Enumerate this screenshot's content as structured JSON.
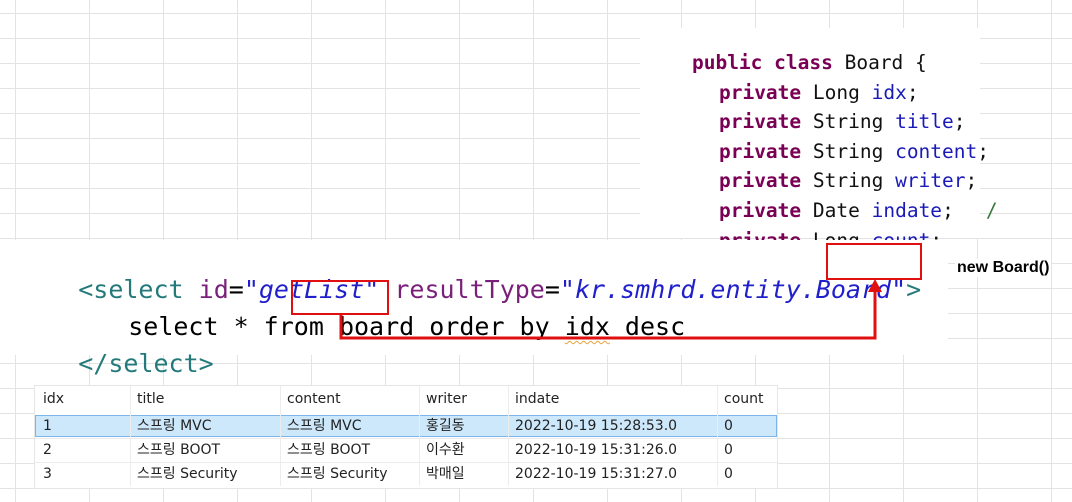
{
  "java": {
    "lines": [
      {
        "keyword": "public class",
        "rest": " Board {",
        "field": "",
        "tail": ""
      },
      {
        "keyword": "private",
        "rest": " Long ",
        "field": "idx",
        "tail": ";"
      },
      {
        "keyword": "private",
        "rest": " String ",
        "field": "title",
        "tail": ";"
      },
      {
        "keyword": "private",
        "rest": " String ",
        "field": "content",
        "tail": ";"
      },
      {
        "keyword": "private",
        "rest": " String ",
        "field": "writer",
        "tail": ";"
      },
      {
        "keyword": "private",
        "rest": " Date ",
        "field": "indate",
        "tail": ";"
      },
      {
        "keyword": "private",
        "rest": " Long ",
        "field": "count",
        "tail": ";"
      }
    ],
    "stray_mark": "/"
  },
  "xml": {
    "open_tag": "<select",
    "id_attr": "id",
    "eq": "=",
    "id_value": "\"getList\"",
    "result_attr": "resultType",
    "result_value_prefix": "\"kr.smhrd.entity.",
    "result_value_class": "Board",
    "quote": "\"",
    "close_bracket": ">",
    "sql_part1": "select * from ",
    "sql_table": "board",
    "sql_part2": " order by ",
    "sql_col": "idx",
    "sql_part3": " desc",
    "close_tag": "</select>"
  },
  "annotation": {
    "new_board": "new Board()"
  },
  "table": {
    "headers": [
      "idx",
      "title",
      "content",
      "writer",
      "indate",
      "count"
    ],
    "rows": [
      [
        "1",
        "스프링 MVC",
        "스프링 MVC",
        "홍길동",
        "2022-10-19 15:28:53.0",
        "0"
      ],
      [
        "2",
        "스프링 BOOT",
        "스프링 BOOT",
        "이수환",
        "2022-10-19 15:31:26.0",
        "0"
      ],
      [
        "3",
        "스프링 Security",
        "스프링 Security",
        "박매일",
        "2022-10-19 15:31:27.0",
        "0"
      ]
    ],
    "selected_row": 0
  },
  "colors": {
    "keyword": "#7a0055",
    "field": "#1a1ab8",
    "xml_tag": "#247a7a",
    "xml_attr": "#7a1f7a",
    "xml_string": "#1f1fcc",
    "highlight": "#e01010",
    "selected_row": "#cde8fb"
  }
}
